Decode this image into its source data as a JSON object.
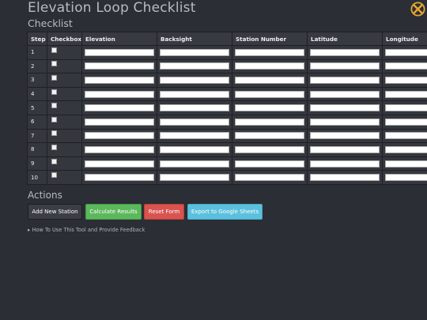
{
  "header": {
    "title": "Elevation Loop Checklist",
    "subtitle": "Checklist",
    "logo_icon": "crossed-tools-logo-icon"
  },
  "table": {
    "columns": [
      "Step",
      "Checkbox",
      "Elevation",
      "Backsight",
      "Station Number",
      "Latitude",
      "Longitude"
    ],
    "rows": [
      {
        "step": "1"
      },
      {
        "step": "2"
      },
      {
        "step": "3"
      },
      {
        "step": "4"
      },
      {
        "step": "5"
      },
      {
        "step": "6"
      },
      {
        "step": "7"
      },
      {
        "step": "8"
      },
      {
        "step": "9"
      },
      {
        "step": "10"
      }
    ]
  },
  "actions": {
    "label": "Actions",
    "add_station": "Add New Station",
    "calculate": "Calculate Results",
    "reset": "Reset Form",
    "export": "Export to Google Sheets"
  },
  "help": {
    "marker": "▸",
    "label": "How To Use This Tool and Provide Feedback"
  },
  "colors": {
    "background": "#2b2e34",
    "calculate": "#5cb85c",
    "reset": "#d9534f",
    "export": "#5bc0de"
  }
}
